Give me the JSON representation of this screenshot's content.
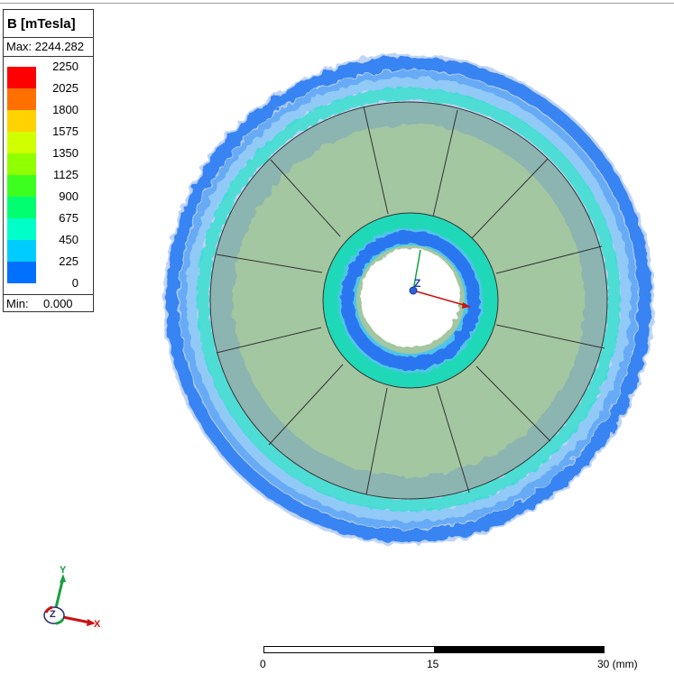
{
  "legend": {
    "title": "B [mTesla]",
    "max_label": "Max: 2244.282",
    "min_label": "Min:",
    "min_value": "0.000",
    "levels": [
      {
        "value": "2250",
        "color": "#ff0000"
      },
      {
        "value": "2025",
        "color": "#ff7000"
      },
      {
        "value": "1800",
        "color": "#ffd200"
      },
      {
        "value": "1575",
        "color": "#d0ff00"
      },
      {
        "value": "1350",
        "color": "#90ff00"
      },
      {
        "value": "1125",
        "color": "#3cff20"
      },
      {
        "value": "900",
        "color": "#00ff70"
      },
      {
        "value": "675",
        "color": "#00ffc8"
      },
      {
        "value": "450",
        "color": "#00ccff"
      },
      {
        "value": "225",
        "color": "#0070ff"
      },
      {
        "value": "0",
        "color": "#0010ff"
      }
    ]
  },
  "plot": {
    "axis_label": "Z"
  },
  "triad": {
    "y_label": "Y",
    "x_label": "X",
    "z_label": "Z"
  },
  "scale_bar": {
    "tick_0": "0",
    "tick_mid": "15",
    "tick_end": "30 (mm)"
  }
}
